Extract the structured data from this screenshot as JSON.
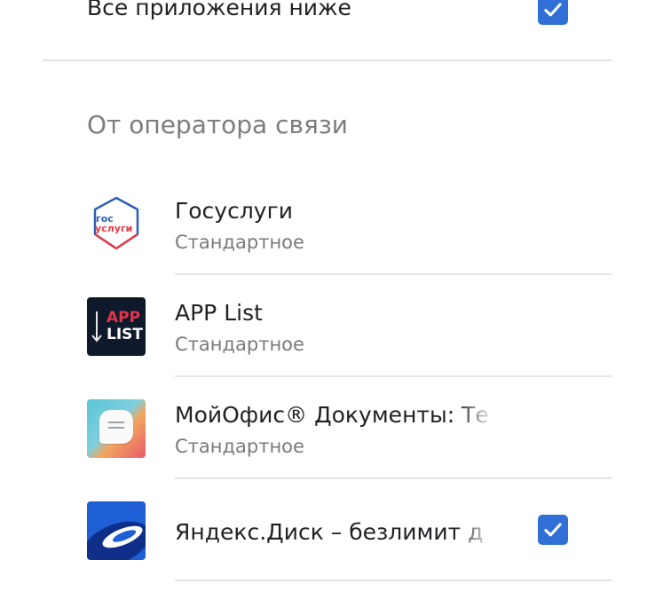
{
  "all_apps": {
    "label": "Все приложения ниже",
    "checked": true
  },
  "section": {
    "title": "От оператора связи"
  },
  "apps": [
    {
      "title": "Госуслуги",
      "subtitle": "Стандартное",
      "icon_text_top": "гос",
      "icon_text_bottom": "услуги",
      "checked": false
    },
    {
      "title": "APP List",
      "subtitle": "Стандартное",
      "icon_text_top": "APP",
      "icon_text_bottom": "LIST",
      "checked": false
    },
    {
      "title": "МойОфис® Документы: Те",
      "subtitle": "Стандартное",
      "checked": false
    },
    {
      "title": "Яндекс.Диск – безлимит д",
      "subtitle": "",
      "checked": true
    }
  ],
  "colors": {
    "accent": "#2f6fd6",
    "divider": "#e3e3e3",
    "secondary_text": "#7a7a7a"
  }
}
